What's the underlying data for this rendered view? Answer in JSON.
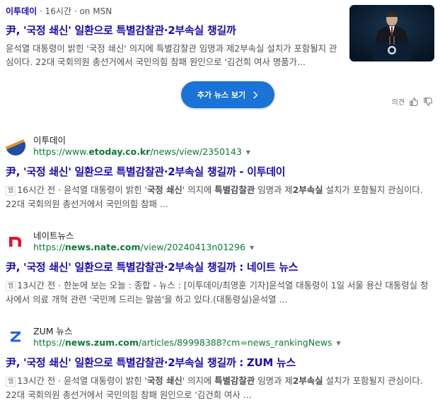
{
  "top_news": {
    "source_name": "이투데이",
    "age": "16시간",
    "via": "on MSN",
    "title": "尹, '국정 쇄신' 일환으로 특별감찰관·2부속실 챙길까",
    "snippet": "윤석열 대통령이 밝힌 '국정 쇄신' 의지에 특별감찰관 임명과 제2부속실 설치가 포함될지 관심이다. 22대 국회의원 총선거에서 국민의힘 참패 원인으로 '김건희 여사 명품가...",
    "thumbnail": "speaker-at-podium-photo"
  },
  "more_news_button": {
    "label": "추가 뉴스 보기"
  },
  "feedback": {
    "label": "의견"
  },
  "results": [
    {
      "site": "이투데이",
      "url_prefix": "https://www.",
      "url_domain": "etoday.co.kr",
      "url_path": "/news/view/2350143",
      "title": "尹, '국정 쇄신' 일환으로 특별감찰관·2부속실 챙길까 - 이투데이",
      "tag": "웹",
      "meta": "16시간 전 · ",
      "snippet_parts": [
        "윤석열 대통령이 밝힌 '",
        "국정 쇄신",
        "' 의지에 ",
        "특별감찰관",
        " 임명과 제",
        "2부속실",
        " 설치가 포함될지 관심이다. 22대 국회의원 총선거에서 국민의힘 참패 ..."
      ]
    },
    {
      "site": "네이트뉴스",
      "url_prefix": "https://",
      "url_domain": "news.nate.com",
      "url_path": "/view/20240413n01296",
      "title": "尹, '국정 쇄신' 일환으로 특별감찰관·2부속실 챙길까 : 네이트 뉴스",
      "tag": "웹",
      "meta": "13시간 전 · ",
      "snippet": "한눈에 보는 오늘 : 종합 - 뉴스 : [이투데이/최영훈 기자]윤석열 대통령이 1일 서울 용산 대통령실 청사에서 의료 개혁 관련 '국민께 드리는 말씀'을 하고 있다.(대통령실)윤석열 ..."
    },
    {
      "site": "ZUM 뉴스",
      "url_prefix": "https://",
      "url_domain": "news.zum.com",
      "url_path": "/articles/89998388?cm=news_rankingNews",
      "title": "尹, '국정 쇄신' 일환으로 특별감찰관·2부속실 챙길까 : ZUM 뉴스",
      "tag": "웹",
      "meta": "13시간 전 · ",
      "snippet_parts": [
        "윤석열 대통령이 밝힌 '",
        "국정 쇄신",
        "' 의지에 ",
        "특별감찰관",
        " 임명과 제",
        "2부속실",
        " 설치가 포함될지 관심이다. 22대 국회의원 총선거에서 국민의힘 참패 원인으로 '김건희 여사 ..."
      ]
    }
  ],
  "colors": {
    "link": "#1a0dab",
    "url": "#0b7a34",
    "button": "#1a73d6"
  }
}
